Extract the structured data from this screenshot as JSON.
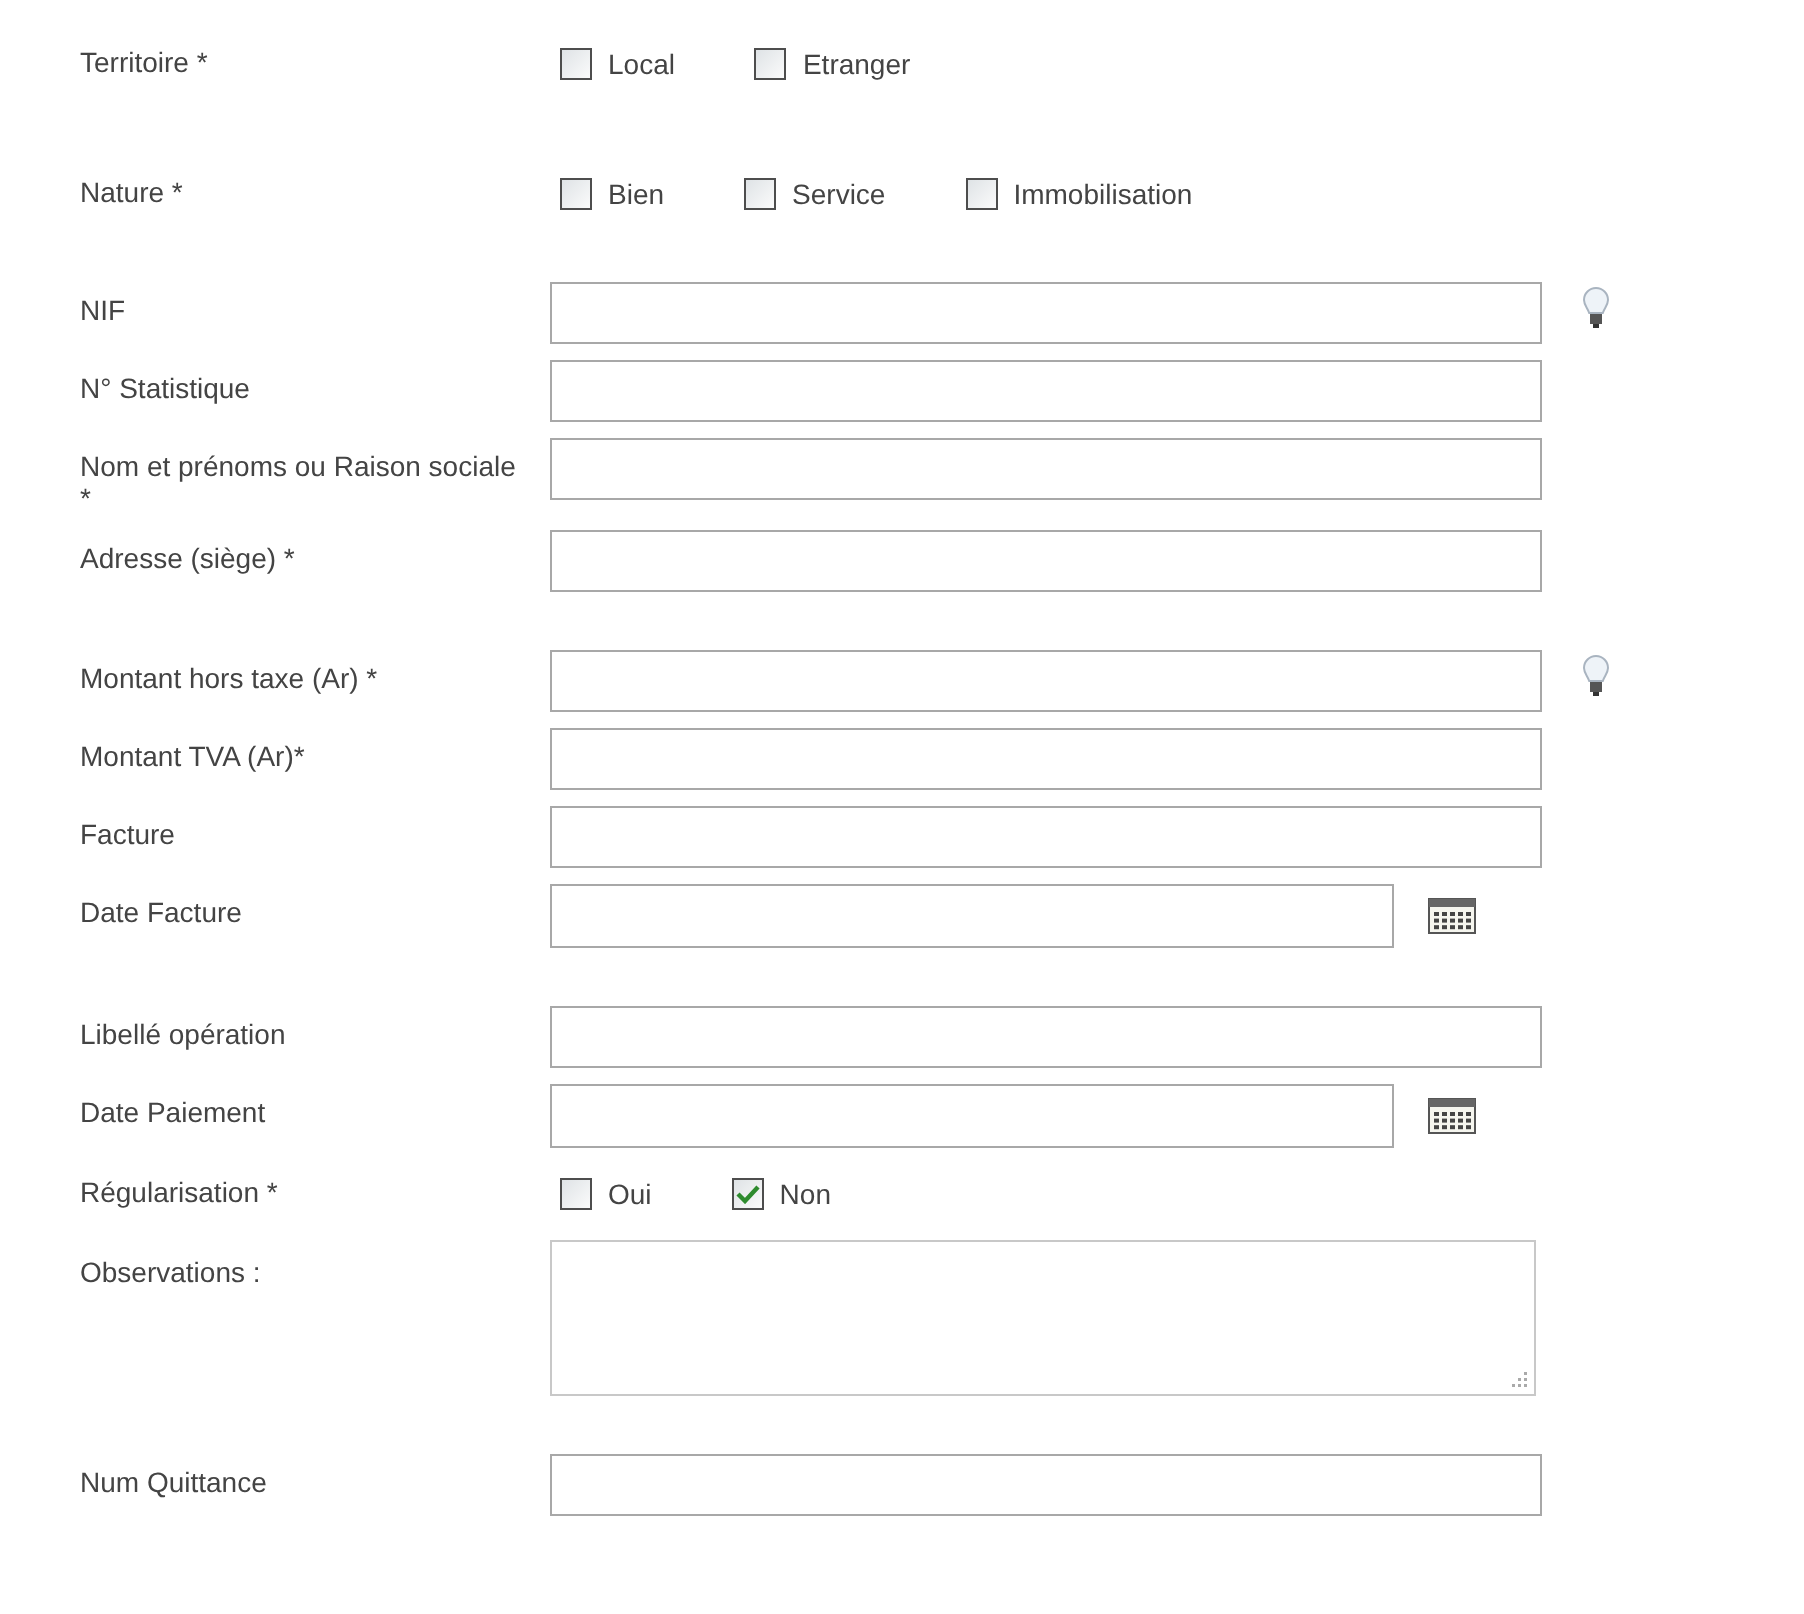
{
  "sections": [
    {
      "fields": [
        {
          "kind": "checks",
          "label": "Territoire *",
          "options": [
            {
              "label": "Local",
              "checked": false
            },
            {
              "label": "Etranger",
              "checked": false
            }
          ]
        },
        {
          "kind": "checks",
          "label": "Nature *",
          "options": [
            {
              "label": "Bien",
              "checked": false
            },
            {
              "label": "Service",
              "checked": false
            },
            {
              "label": "Immobilisation",
              "checked": false
            }
          ]
        }
      ]
    },
    {
      "fields": [
        {
          "kind": "hinted",
          "label": "NIF"
        },
        {
          "kind": "text",
          "label": "N° Statistique"
        },
        {
          "kind": "text",
          "label": "Nom et prénoms ou Raison sociale *"
        },
        {
          "kind": "text",
          "label": "Adresse (siège) *"
        }
      ]
    },
    {
      "fields": [
        {
          "kind": "hinted",
          "label": "Montant hors taxe (Ar) *"
        },
        {
          "kind": "text",
          "label": "Montant TVA (Ar)*"
        },
        {
          "kind": "text",
          "label": "Facture"
        },
        {
          "kind": "date",
          "label": "Date Facture"
        }
      ]
    },
    {
      "fields": [
        {
          "kind": "text",
          "label": "Libellé opération"
        },
        {
          "kind": "date",
          "label": "Date Paiement"
        },
        {
          "kind": "checks",
          "label": "Régularisation *",
          "options": [
            {
              "label": "Oui",
              "checked": false
            },
            {
              "label": "Non",
              "checked": true
            }
          ]
        },
        {
          "kind": "textarea",
          "label": "Observations :"
        }
      ]
    },
    {
      "fields": [
        {
          "kind": "text",
          "label": "Num Quittance"
        }
      ]
    }
  ]
}
